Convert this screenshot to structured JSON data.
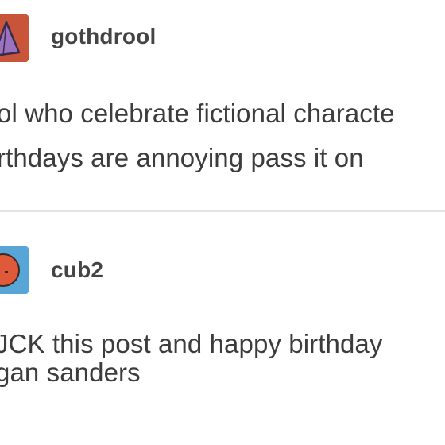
{
  "posts": [
    {
      "username": "gothdrool",
      "avatar_icon": "purple-triangle-avatar-icon",
      "avatar_color": "#c8553a",
      "lines": [
        "ol who celebrate fictional characte",
        "rthdays are annoying pass it on"
      ]
    },
    {
      "username": "cub2",
      "avatar_icon": "orange-face-avatar-icon",
      "avatar_color": "#58a6d8",
      "lines": [
        "JCK this post and happy birthday",
        "gan sanders"
      ]
    }
  ]
}
